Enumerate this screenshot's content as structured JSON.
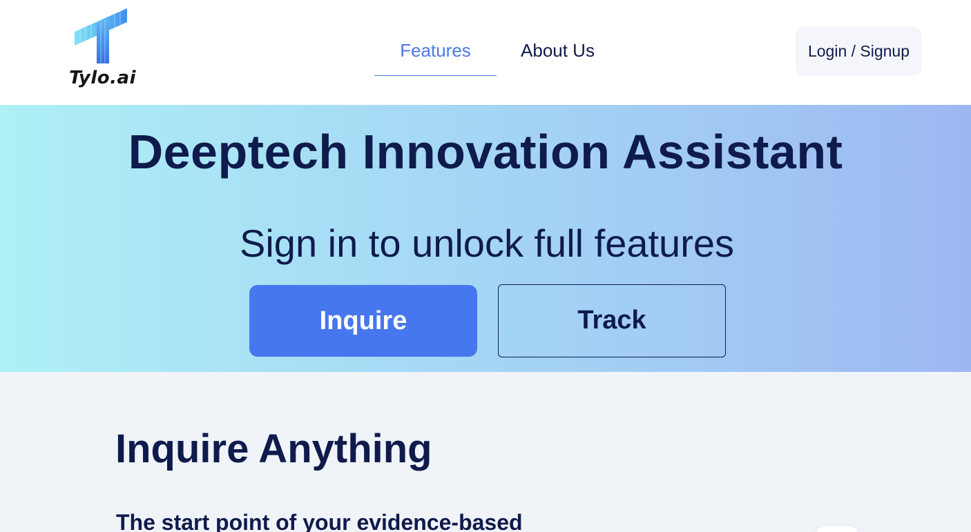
{
  "brand": {
    "name": "Tylo.ai",
    "accent_color": "#4777ee",
    "text_color": "#0f1b4c"
  },
  "nav": {
    "items": [
      {
        "label": "Features",
        "active": true
      },
      {
        "label": "About Us",
        "active": false
      }
    ],
    "login_label": "Login / Signup"
  },
  "hero": {
    "title": "Deeptech Innovation Assistant",
    "subtitle": "Sign in to unlock full features",
    "primary_button": "Inquire",
    "secondary_button": "Track"
  },
  "section": {
    "title": "Inquire Anything",
    "description": "The start point of your evidence-based"
  }
}
